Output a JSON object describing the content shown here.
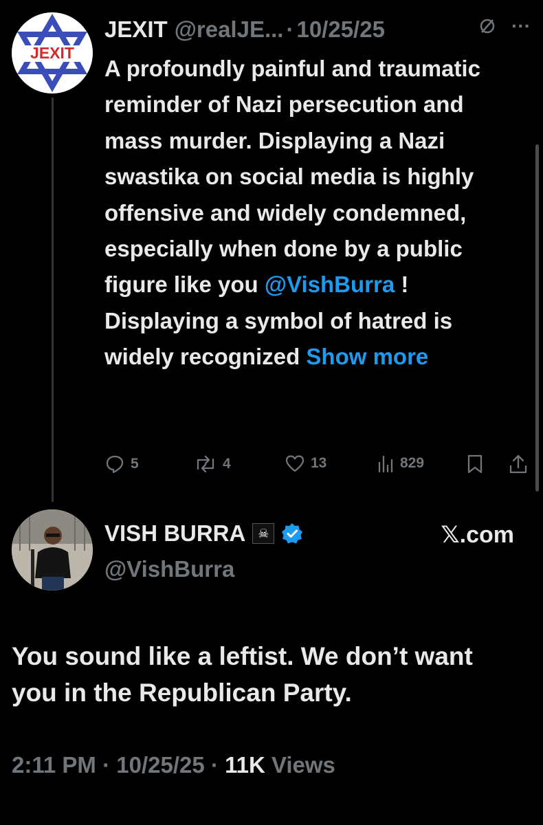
{
  "parent_tweet": {
    "avatar_text": "JEXIT",
    "display_name": "JEXIT",
    "handle": "@realJE...",
    "separator": "·",
    "date": "10/25/25",
    "grok_icon": "slash-circle-icon",
    "more_icon": "···",
    "text_before_mention": "A profoundly painful and traumatic reminder of Nazi persecution and mass murder. Displaying a Nazi swastika on social media is highly offensive and widely condemned, especially when done by a public figure like you ",
    "mention": "@VishBurra",
    "text_after_mention": " ! Displaying a symbol of hatred is widely recognized ",
    "show_more": "Show more",
    "replies": "5",
    "reposts": "4",
    "likes": "13",
    "views": "829"
  },
  "main_tweet": {
    "display_name": "VISH BURRA",
    "flag_icon": "pirate-flag-icon",
    "flag_glyph": "☠",
    "verified_icon": "verified-badge-icon",
    "handle": "@VishBurra",
    "watermark": "𝕏.com",
    "text": "You sound like a leftist. We don’t want you in the Republican Party.",
    "time": "2:11 PM",
    "separator": "·",
    "date": "10/25/25",
    "views_count": "11K",
    "views_label": "Views"
  },
  "colors": {
    "background": "#000000",
    "text": "#e7e9ea",
    "muted": "#71767b",
    "accent": "#1d9bf0"
  }
}
